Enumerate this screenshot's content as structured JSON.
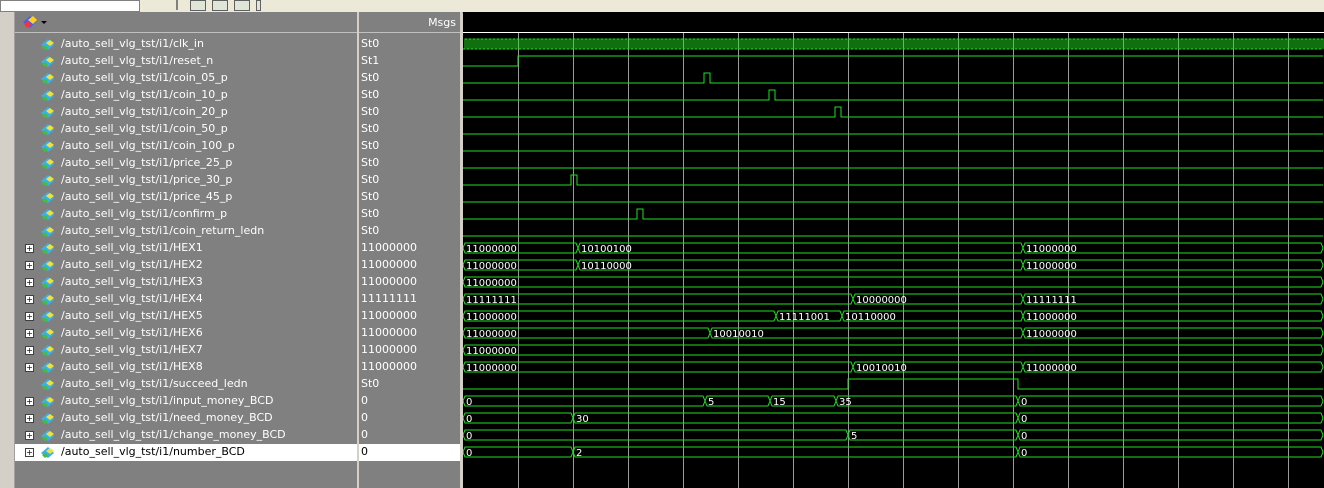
{
  "header": {
    "msgs_label": "Msgs"
  },
  "signals": [
    {
      "name": "/auto_sell_vlg_tst/i1/clk_in",
      "value": "St0",
      "kind": "clock",
      "expandable": false
    },
    {
      "name": "/auto_sell_vlg_tst/i1/reset_n",
      "value": "St1",
      "kind": "bit",
      "expandable": false
    },
    {
      "name": "/auto_sell_vlg_tst/i1/coin_05_p",
      "value": "St0",
      "kind": "bit",
      "expandable": false
    },
    {
      "name": "/auto_sell_vlg_tst/i1/coin_10_p",
      "value": "St0",
      "kind": "bit",
      "expandable": false
    },
    {
      "name": "/auto_sell_vlg_tst/i1/coin_20_p",
      "value": "St0",
      "kind": "bit",
      "expandable": false
    },
    {
      "name": "/auto_sell_vlg_tst/i1/coin_50_p",
      "value": "St0",
      "kind": "bit",
      "expandable": false
    },
    {
      "name": "/auto_sell_vlg_tst/i1/coin_100_p",
      "value": "St0",
      "kind": "bit",
      "expandable": false
    },
    {
      "name": "/auto_sell_vlg_tst/i1/price_25_p",
      "value": "St0",
      "kind": "bit",
      "expandable": false
    },
    {
      "name": "/auto_sell_vlg_tst/i1/price_30_p",
      "value": "St0",
      "kind": "bit",
      "expandable": false
    },
    {
      "name": "/auto_sell_vlg_tst/i1/price_45_p",
      "value": "St0",
      "kind": "bit",
      "expandable": false
    },
    {
      "name": "/auto_sell_vlg_tst/i1/confirm_p",
      "value": "St0",
      "kind": "bit",
      "expandable": false
    },
    {
      "name": "/auto_sell_vlg_tst/i1/coin_return_ledn",
      "value": "St0",
      "kind": "bit",
      "expandable": false
    },
    {
      "name": "/auto_sell_vlg_tst/i1/HEX1",
      "value": "11000000",
      "kind": "bus",
      "expandable": true
    },
    {
      "name": "/auto_sell_vlg_tst/i1/HEX2",
      "value": "11000000",
      "kind": "bus",
      "expandable": true
    },
    {
      "name": "/auto_sell_vlg_tst/i1/HEX3",
      "value": "11000000",
      "kind": "bus",
      "expandable": true
    },
    {
      "name": "/auto_sell_vlg_tst/i1/HEX4",
      "value": "11111111",
      "kind": "bus",
      "expandable": true
    },
    {
      "name": "/auto_sell_vlg_tst/i1/HEX5",
      "value": "11000000",
      "kind": "bus",
      "expandable": true
    },
    {
      "name": "/auto_sell_vlg_tst/i1/HEX6",
      "value": "11000000",
      "kind": "bus",
      "expandable": true
    },
    {
      "name": "/auto_sell_vlg_tst/i1/HEX7",
      "value": "11000000",
      "kind": "bus",
      "expandable": true
    },
    {
      "name": "/auto_sell_vlg_tst/i1/HEX8",
      "value": "11000000",
      "kind": "bus",
      "expandable": true
    },
    {
      "name": "/auto_sell_vlg_tst/i1/succeed_ledn",
      "value": "St0",
      "kind": "bit",
      "expandable": false
    },
    {
      "name": "/auto_sell_vlg_tst/i1/input_money_BCD",
      "value": "0",
      "kind": "bus",
      "expandable": true
    },
    {
      "name": "/auto_sell_vlg_tst/i1/need_money_BCD",
      "value": "0",
      "kind": "bus",
      "expandable": true
    },
    {
      "name": "/auto_sell_vlg_tst/i1/change_money_BCD",
      "value": "0",
      "kind": "bus",
      "expandable": true
    },
    {
      "name": "/auto_sell_vlg_tst/i1/number_BCD",
      "value": "0",
      "kind": "bus",
      "expandable": true,
      "selected": true
    }
  ],
  "waves": {
    "timeline": {
      "start": 0,
      "end": 860
    },
    "gridlines": [
      55,
      110,
      165,
      220,
      275,
      330,
      385,
      440,
      495,
      550,
      605,
      660,
      715,
      770,
      825
    ],
    "bits": {
      "1": {
        "init": 0,
        "edges": [
          55
        ]
      },
      "2": {
        "pulses": [
          [
            241,
            247
          ]
        ]
      },
      "3": {
        "pulses": [
          [
            306,
            312
          ]
        ]
      },
      "4": {
        "pulses": [
          [
            372,
            378
          ]
        ]
      },
      "8": {
        "pulses": [
          [
            108,
            114
          ]
        ]
      },
      "10": {
        "pulses": [
          [
            174,
            180
          ]
        ]
      },
      "20": {
        "init": 0,
        "edges": [
          385,
          555
        ]
      }
    },
    "buses": {
      "12": [
        [
          0,
          "11000000"
        ],
        [
          115,
          "10100100"
        ],
        [
          560,
          "11000000"
        ]
      ],
      "13": [
        [
          0,
          "11000000"
        ],
        [
          115,
          "10110000"
        ],
        [
          560,
          "11000000"
        ]
      ],
      "14": [
        [
          0,
          "11000000"
        ]
      ],
      "15": [
        [
          0,
          "11111111"
        ],
        [
          390,
          "10000000"
        ],
        [
          560,
          "11111111"
        ]
      ],
      "16": [
        [
          0,
          "11000000"
        ],
        [
          313,
          "11111001"
        ],
        [
          379,
          "10110000"
        ],
        [
          560,
          "11000000"
        ]
      ],
      "17": [
        [
          0,
          "11000000"
        ],
        [
          247,
          "10010010"
        ],
        [
          560,
          "11000000"
        ]
      ],
      "18": [
        [
          0,
          "11000000"
        ]
      ],
      "19": [
        [
          0,
          "11000000"
        ],
        [
          390,
          "10010010"
        ],
        [
          560,
          "11000000"
        ]
      ],
      "21": [
        [
          0,
          "0"
        ],
        [
          242,
          "5"
        ],
        [
          307,
          "15"
        ],
        [
          373,
          "35"
        ],
        [
          555,
          "0"
        ]
      ],
      "22": [
        [
          0,
          "0"
        ],
        [
          110,
          "30"
        ],
        [
          555,
          "0"
        ]
      ],
      "23": [
        [
          0,
          "0"
        ],
        [
          385,
          "5"
        ],
        [
          555,
          "0"
        ]
      ],
      "24": [
        [
          0,
          "0"
        ],
        [
          110,
          "2"
        ],
        [
          555,
          "0"
        ]
      ]
    }
  }
}
